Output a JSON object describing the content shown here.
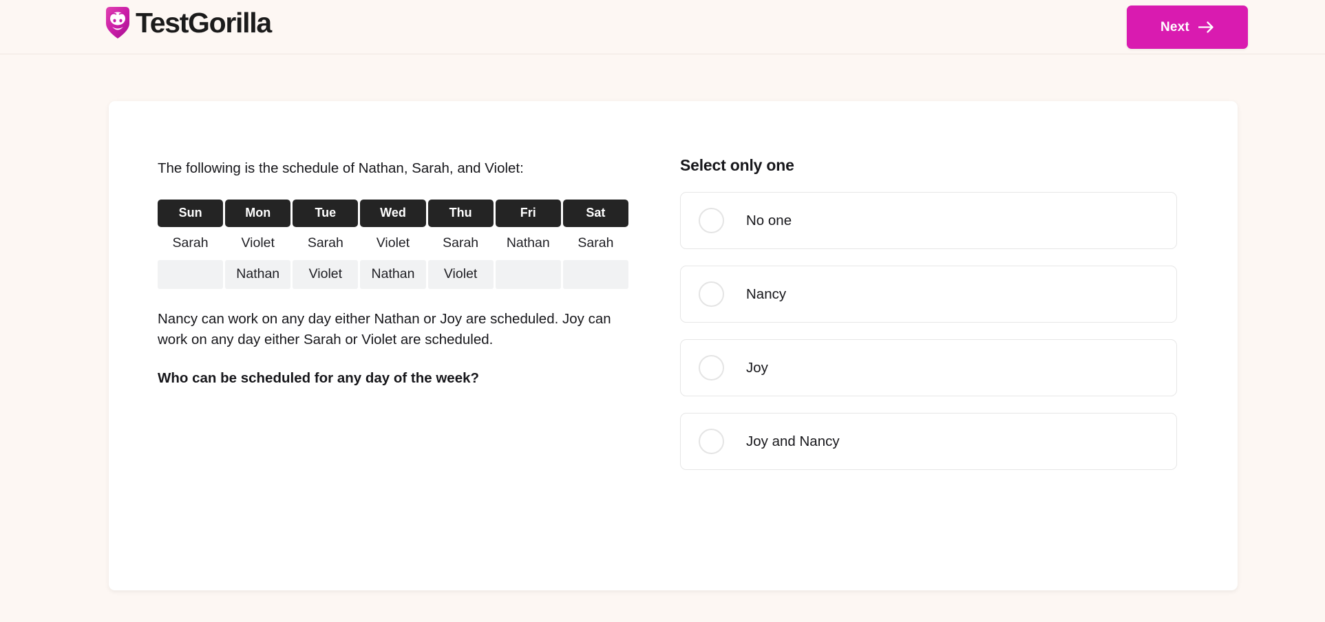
{
  "header": {
    "logo_text": "TestGorilla",
    "logo_icon": "gorilla-shield-icon",
    "next_label": "Next",
    "next_icon": "arrow-right-icon",
    "brand_color": "#d91bb0",
    "background_color": "#fdf7f3"
  },
  "question": {
    "intro": "The following is the schedule of Nathan, Sarah, and Violet:",
    "body": "Nancy can work on any day either Nathan or Joy are scheduled. Joy can work on any day either Sarah or Violet are scheduled.",
    "prompt": "Who can be scheduled for any day of the week?"
  },
  "schedule": {
    "headers": [
      "Sun",
      "Mon",
      "Tue",
      "Wed",
      "Thu",
      "Fri",
      "Sat"
    ],
    "rows": [
      [
        "Sarah",
        "Violet",
        "Sarah",
        "Violet",
        "Sarah",
        "Nathan",
        "Sarah"
      ],
      [
        "",
        "Nathan",
        "Violet",
        "Nathan",
        "Violet",
        "",
        ""
      ]
    ],
    "header_background": "#242424",
    "row_alt_background": "#f1f2f3"
  },
  "answers": {
    "heading": "Select only one",
    "options": [
      {
        "label": "No one",
        "selected": false
      },
      {
        "label": "Nancy",
        "selected": false
      },
      {
        "label": "Joy",
        "selected": false
      },
      {
        "label": "Joy and Nancy",
        "selected": false
      }
    ]
  }
}
